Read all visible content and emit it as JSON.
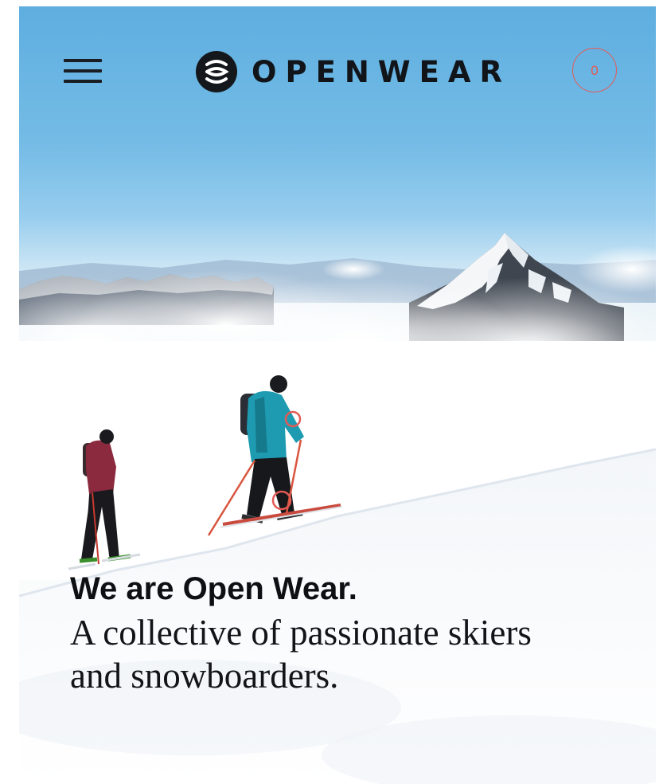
{
  "header": {
    "brand": {
      "name": "OPENWEAR",
      "logo_icon": "openwear-logo-icon"
    },
    "menu_icon": "hamburger-menu-icon",
    "cart": {
      "count": "0",
      "accent_color": "#e45a55"
    }
  },
  "hero": {
    "title": "We are Open Wear.",
    "subtitle": "A collective of passionate skiers and snowboarders.",
    "image_subject": "two ski tourers climbing a snowy slope above the clouds",
    "hotspot_color": "#e45a55"
  }
}
